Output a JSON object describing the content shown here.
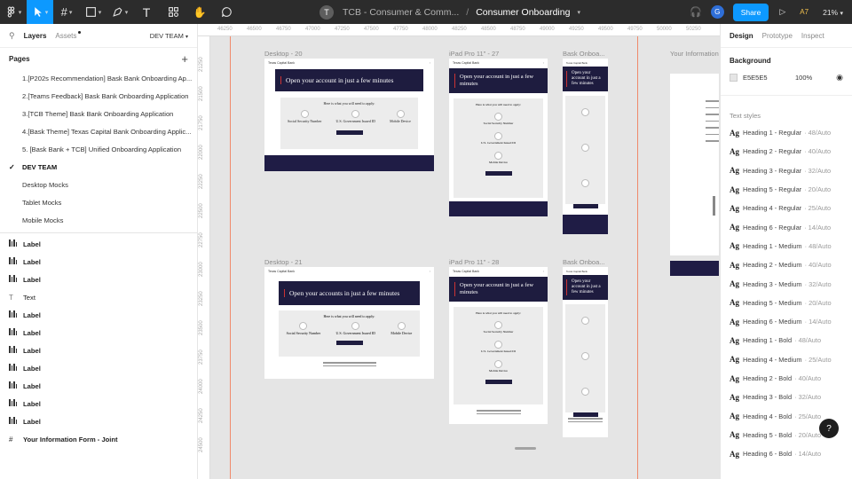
{
  "topbar": {
    "project_initial": "T",
    "project_name": "TCB - Consumer & Comm...",
    "separator": "/",
    "file_name": "Consumer Onboarding",
    "user_initial": "G",
    "share_label": "Share",
    "a7_label": "A7",
    "zoom": "21%"
  },
  "left": {
    "tab_layers": "Layers",
    "tab_assets": "Assets",
    "current_page_select": "DEV TEAM",
    "pages_header": "Pages",
    "pages": [
      "1.[P202s Recommendation] Bask Bank Onboarding Ap...",
      "2.[Teams Feedback] Bask Bank Onboarding Application",
      "3.[TCB Theme] Bask Bank Onboarding  Application",
      "4.[Bask Theme] Texas Capital Bank Onboarding Applic...",
      "5. [Bask Bank + TCB] Unified Onboarding Application",
      "DEV TEAM",
      "Desktop Mocks",
      "Tablet Mocks",
      "Mobile Mocks"
    ],
    "layers": [
      {
        "icon": "bars",
        "label": "Label"
      },
      {
        "icon": "bars",
        "label": "Label"
      },
      {
        "icon": "bars",
        "label": "Label"
      },
      {
        "icon": "text",
        "label": "Text"
      },
      {
        "icon": "bars",
        "label": "Label"
      },
      {
        "icon": "bars",
        "label": "Label"
      },
      {
        "icon": "bars",
        "label": "Label"
      },
      {
        "icon": "bars",
        "label": "Label"
      },
      {
        "icon": "bars",
        "label": "Label"
      },
      {
        "icon": "bars",
        "label": "Label"
      },
      {
        "icon": "bars",
        "label": "Label"
      },
      {
        "icon": "frame",
        "label": "Your Information Form - Joint"
      }
    ]
  },
  "canvas": {
    "ruler_top": [
      "46250",
      "46500",
      "46750",
      "47000",
      "47250",
      "47500",
      "47750",
      "48000",
      "48250",
      "48500",
      "48750",
      "49000",
      "49250",
      "49500",
      "49750",
      "50000",
      "50250"
    ],
    "ruler_left": [
      "21250",
      "21500",
      "21750",
      "22000",
      "22250",
      "22500",
      "22750",
      "23000",
      "23250",
      "23500",
      "23750",
      "24000",
      "24250",
      "24500"
    ],
    "frames": {
      "desktop20": "Desktop - 20",
      "ipad27": "iPad Pro 11\" - 27",
      "bask1": "Bask Onboa...",
      "your_info": "Your Information",
      "desktop21": "Desktop - 21",
      "ipad28": "iPad Pro 11\" - 28",
      "bask2": "Bask Onboa..."
    },
    "mock": {
      "logo": "Texas Capital Bank",
      "hero_single": "Open your account in just a few minutes",
      "hero_plural": "Open your accounts in just a few minutes",
      "apply_heading": "Here is what you will need to apply:",
      "item1": "Social Security Number",
      "item2": "U.S. Government Issued ID",
      "item3": "Mobile Device"
    }
  },
  "right": {
    "tab_design": "Design",
    "tab_prototype": "Prototype",
    "tab_inspect": "Inspect",
    "background_title": "Background",
    "bg_hex": "E5E5E5",
    "bg_opacity": "100%",
    "bg_color": "#e5e5e5",
    "text_styles_title": "Text styles",
    "ag_glyph": "Ag",
    "styles": [
      {
        "name": "Heading 1 - Regular",
        "meta": "48/Auto"
      },
      {
        "name": "Heading 2 - Regular",
        "meta": "40/Auto"
      },
      {
        "name": "Heading 3 - Regular",
        "meta": "32/Auto"
      },
      {
        "name": "Heading 5 - Regular",
        "meta": "20/Auto"
      },
      {
        "name": "Heading 4 - Regular",
        "meta": "25/Auto"
      },
      {
        "name": "Heading 6 - Regular",
        "meta": "14/Auto"
      },
      {
        "name": "Heading 1 - Medium",
        "meta": "48/Auto"
      },
      {
        "name": "Heading 2 - Medium",
        "meta": "40/Auto"
      },
      {
        "name": "Heading 3 - Medium",
        "meta": "32/Auto"
      },
      {
        "name": "Heading 5 - Medium",
        "meta": "20/Auto"
      },
      {
        "name": "Heading 6 - Medium",
        "meta": "14/Auto"
      },
      {
        "name": "Heading 1 - Bold",
        "meta": "48/Auto"
      },
      {
        "name": "Heading 4 - Medium",
        "meta": "25/Auto"
      },
      {
        "name": "Heading 2 - Bold",
        "meta": "40/Auto"
      },
      {
        "name": "Heading 3 - Bold",
        "meta": "32/Auto"
      },
      {
        "name": "Heading 4 - Bold",
        "meta": "25/Auto"
      },
      {
        "name": "Heading 5 - Bold",
        "meta": "20/Auto"
      },
      {
        "name": "Heading 6 - Bold",
        "meta": "14/Auto"
      }
    ],
    "help": "?"
  }
}
